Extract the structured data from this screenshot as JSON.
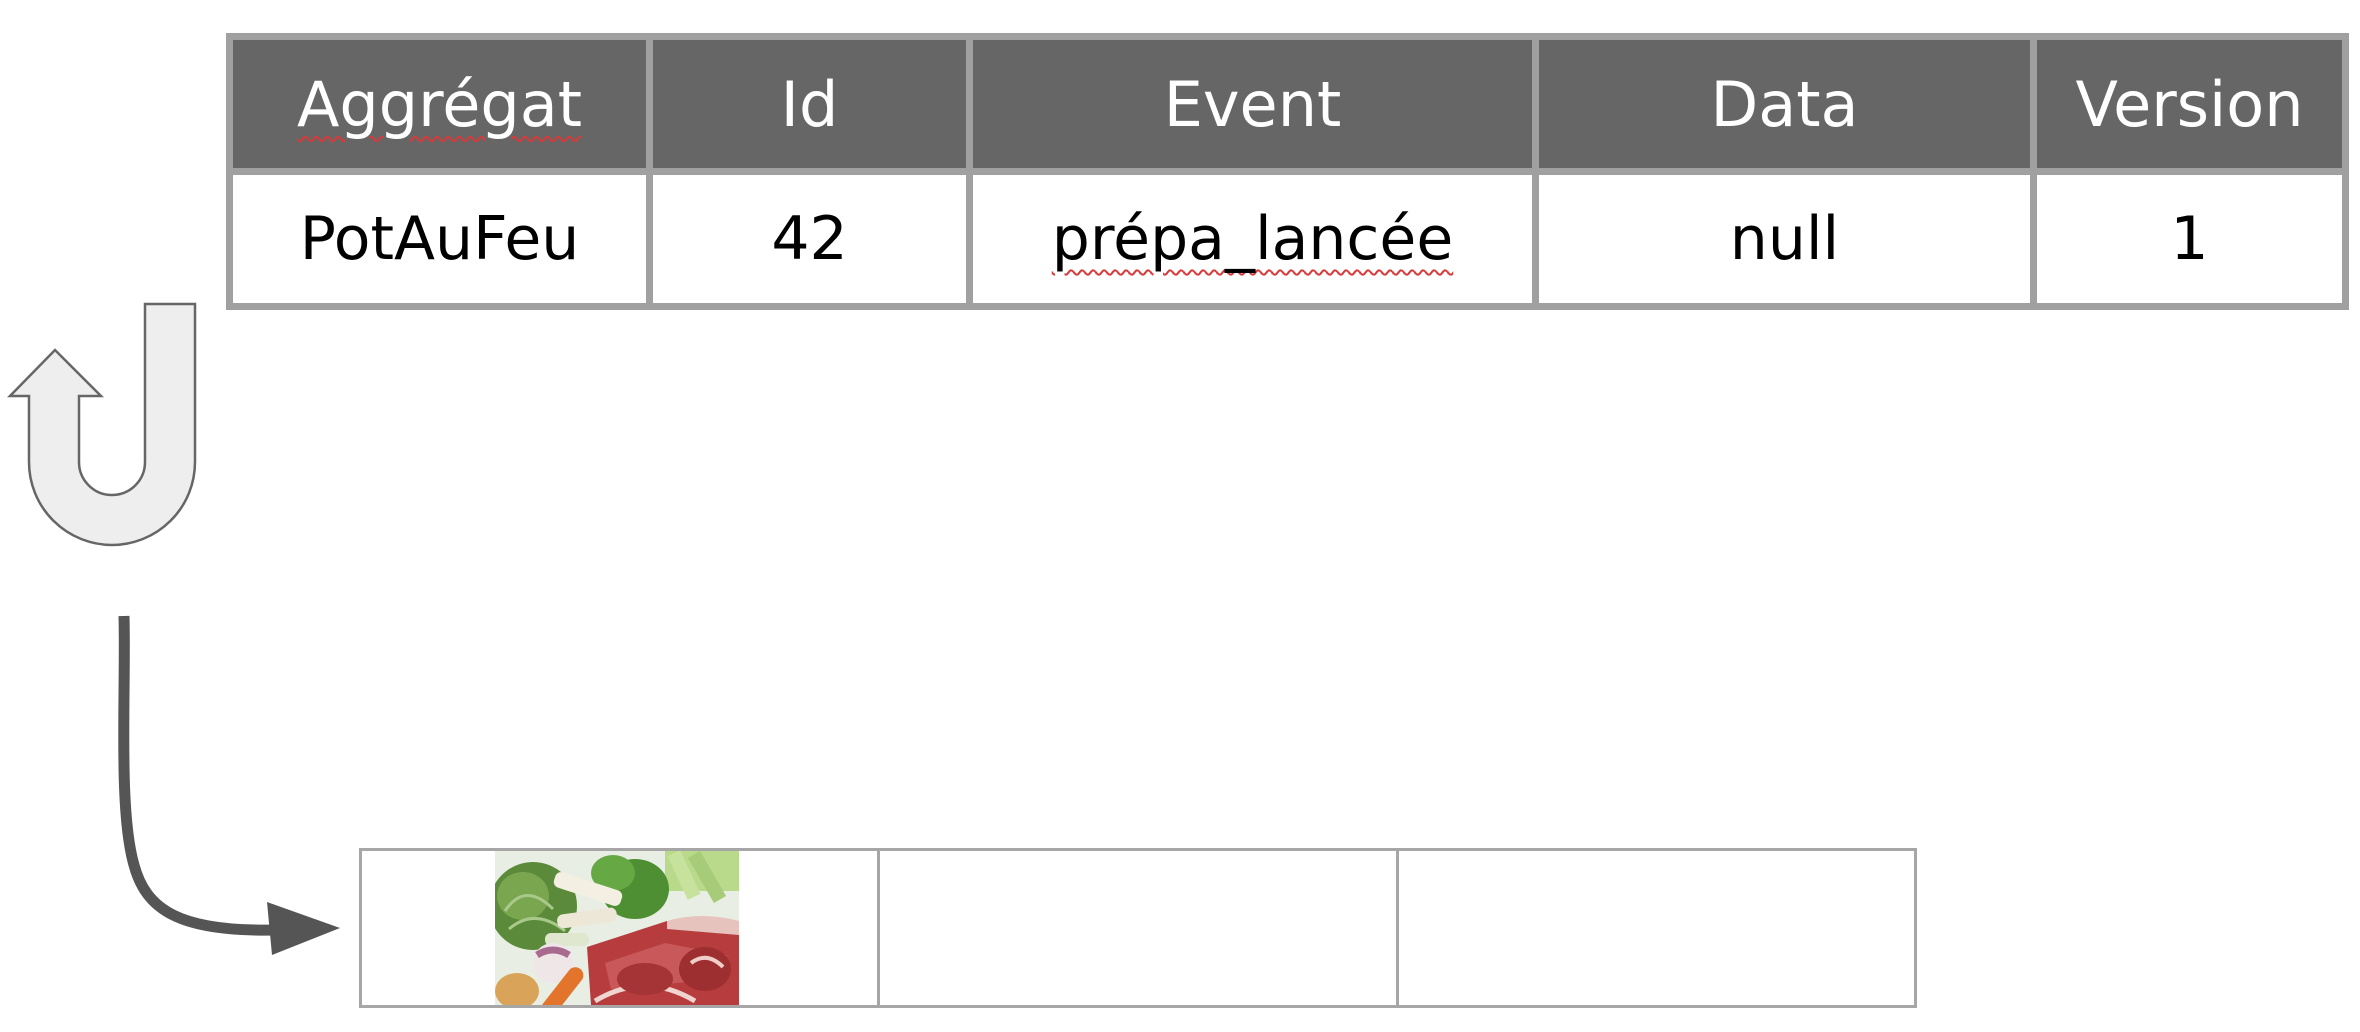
{
  "table": {
    "headers": [
      "Aggrégat",
      "Id",
      "Event",
      "Data",
      "Version"
    ],
    "row": [
      "PotAuFeu",
      "42",
      "prépa_lancée",
      "null",
      "1"
    ]
  },
  "colors": {
    "header_bg": "#666666",
    "header_text": "#ffffff",
    "border": "#a0a0a0",
    "arrow_dark": "#555555",
    "arrow_light": "#eeeeee"
  },
  "icons": {
    "u_turn": "u-turn-arrow-icon",
    "flow": "curved-arrow-icon"
  },
  "slots": {
    "count": 3,
    "filled": [
      true,
      false,
      false
    ]
  }
}
